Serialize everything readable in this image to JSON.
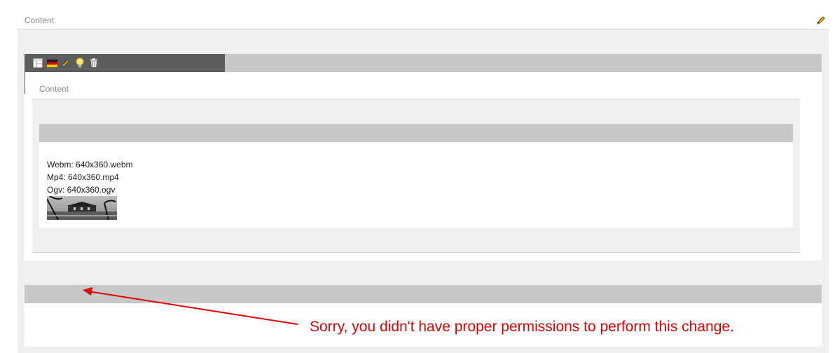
{
  "outer": {
    "label": "Content"
  },
  "inner": {
    "label": "Content"
  },
  "toolbar": {
    "icons": [
      "layout-icon",
      "flag-de-icon",
      "pencil-icon",
      "lightbulb-icon",
      "trash-icon"
    ]
  },
  "media": {
    "webm": "Webm: 640x360.webm",
    "mp4": "Mp4: 640x360.mp4",
    "ogv": "Ogv: 640x360.ogv"
  },
  "message": "Sorry, you didn't have proper permissions to perform this change.",
  "colors": {
    "error": "#e30000",
    "toolbar": "#5d5d5d",
    "bar": "#c8c8c8",
    "panel": "#f0f0f0"
  }
}
